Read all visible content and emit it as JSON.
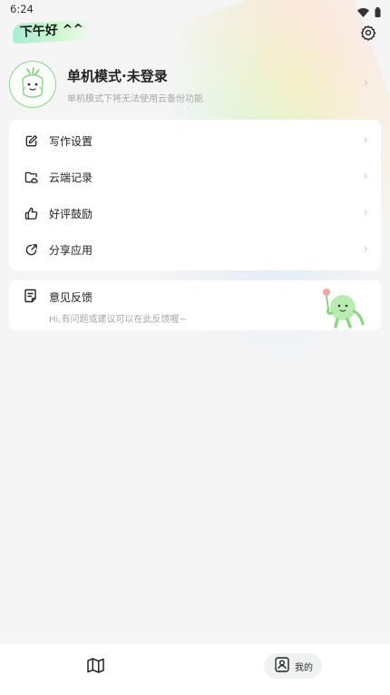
{
  "status_bar": {
    "time": "6:24",
    "icons": [
      "wifi-icon",
      "battery-icon"
    ]
  },
  "header": {
    "greeting": "下午好 ^^",
    "settings_icon": "gear-icon"
  },
  "profile": {
    "title": "单机模式·未登录",
    "subtitle": "单机模式下将无法使用云备份功能",
    "avatar_icon": "mascot-face-icon"
  },
  "menu": {
    "items": [
      {
        "label": "写作设置",
        "icon": "edit-icon"
      },
      {
        "label": "云端记录",
        "icon": "cloud-folder-icon"
      },
      {
        "label": "好评鼓励",
        "icon": "thumbs-up-icon"
      },
      {
        "label": "分享应用",
        "icon": "share-icon"
      }
    ],
    "chevron": "›"
  },
  "feedback": {
    "title": "意见反馈",
    "subtitle": "Hi,有问题或建议可以在此反馈喔~",
    "icon": "feedback-note-icon"
  },
  "bottom_nav": {
    "tabs": [
      {
        "icon": "map-icon",
        "label": ""
      },
      {
        "icon": "profile-icon",
        "label": "我的",
        "active": true
      }
    ]
  },
  "colors": {
    "accent_green": "#2aa86c",
    "mascot_green": "#9be08a",
    "background": "#f5f5f5"
  }
}
